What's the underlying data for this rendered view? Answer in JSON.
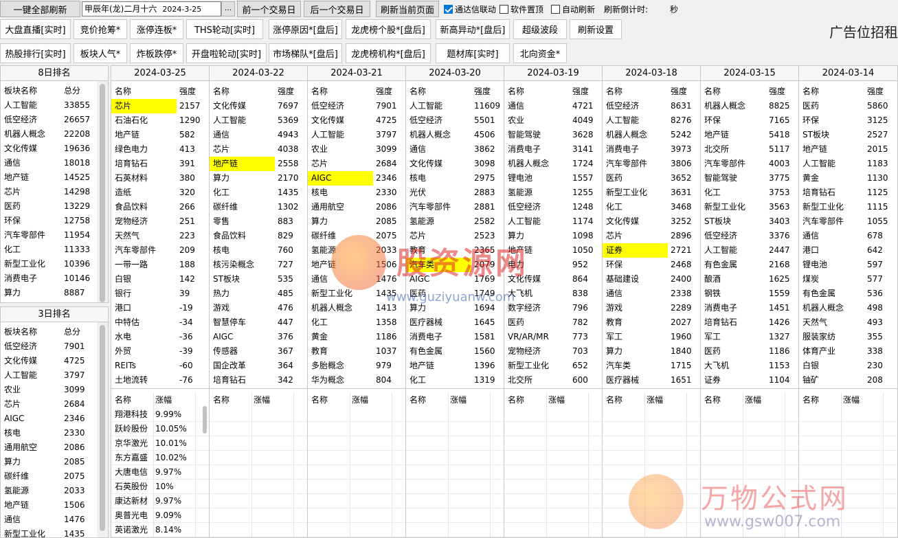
{
  "toolbar": {
    "refresh_all": "一键全部刷新",
    "date_lunar": "甲辰年(龙)二月十六",
    "date_iso": "2024-3-25",
    "dots": "...",
    "prev_day": "前一个交易日",
    "next_day": "后一个交易日",
    "refresh_page": "刷新当前页面",
    "tdx_link": "通达信联动",
    "pin_top": "软件置顶",
    "auto_refresh": "自动刷新",
    "countdown_label": "刷新倒计时:",
    "seconds": "秒",
    "ad_text": "广告位招租"
  },
  "nav_row1": [
    "大盘直播[实时]",
    "竞价抢筹*",
    "涨停连板*",
    "THS轮动[实时]",
    "涨停原因*[盘后]",
    "龙虎榜个股*[盘后]",
    "新高异动*[盘后]",
    "超级波段",
    "刷新设置"
  ],
  "nav_row2": [
    "热股排行[实时]",
    "板块人气*",
    "炸板跌停*",
    "开盘啦轮动[实时]",
    "市场梯队*[盘后]",
    "龙虎榜机构*[盘后]",
    "题材库[实时]",
    "北向资金*"
  ],
  "rank8": {
    "title": "8日排名",
    "col1": "板块名称",
    "col2": "总分",
    "rows": [
      [
        "人工智能",
        "33855"
      ],
      [
        "低空经济",
        "26657"
      ],
      [
        "机器人概念",
        "22208"
      ],
      [
        "文化传媒",
        "19636"
      ],
      [
        "通信",
        "18018"
      ],
      [
        "地产链",
        "14525"
      ],
      [
        "芯片",
        "14298"
      ],
      [
        "医药",
        "13229"
      ],
      [
        "环保",
        "12758"
      ],
      [
        "汽车零部件",
        "11954"
      ],
      [
        "化工",
        "11333"
      ],
      [
        "新型工业化",
        "10396"
      ],
      [
        "消费电子",
        "10146"
      ],
      [
        "算力",
        "8887"
      ]
    ]
  },
  "rank3": {
    "title": "3日排名",
    "col1": "板块名称",
    "col2": "总分",
    "rows": [
      [
        "低空经济",
        "7901"
      ],
      [
        "文化传媒",
        "4725"
      ],
      [
        "人工智能",
        "3797"
      ],
      [
        "农业",
        "3099"
      ],
      [
        "芯片",
        "2684"
      ],
      [
        "AIGC",
        "2346"
      ],
      [
        "核电",
        "2330"
      ],
      [
        "通用航空",
        "2086"
      ],
      [
        "算力",
        "2085"
      ],
      [
        "碳纤维",
        "2075"
      ],
      [
        "氢能源",
        "2033"
      ],
      [
        "地产链",
        "1506"
      ],
      [
        "通信",
        "1476"
      ],
      [
        "新型工业化",
        "1435"
      ]
    ]
  },
  "days": [
    {
      "date": "2024-03-25",
      "col1": "名称",
      "col2": "强度",
      "hl": 0,
      "rows": [
        [
          "芯片",
          "2157"
        ],
        [
          "石油石化",
          "1290"
        ],
        [
          "地产链",
          "582"
        ],
        [
          "绿色电力",
          "413"
        ],
        [
          "培育钻石",
          "391"
        ],
        [
          "石英材料",
          "380"
        ],
        [
          "造纸",
          "320"
        ],
        [
          "食品饮料",
          "266"
        ],
        [
          "宠物经济",
          "251"
        ],
        [
          "天然气",
          "223"
        ],
        [
          "汽车零部件",
          "209"
        ],
        [
          "一带一路",
          "188"
        ],
        [
          "白银",
          "142"
        ],
        [
          "银行",
          "39"
        ],
        [
          "港口",
          "-19"
        ],
        [
          "中特估",
          "-34"
        ],
        [
          "水电",
          "-36"
        ],
        [
          "外贸",
          "-39"
        ],
        [
          "REITs",
          "-60"
        ],
        [
          "土地流转",
          "-76"
        ]
      ],
      "b1": "名称",
      "b2": "涨幅",
      "stocks": [
        [
          "翔港科技",
          "9.99%"
        ],
        [
          "跃岭股份",
          "10.05%"
        ],
        [
          "京华激光",
          "10.01%"
        ],
        [
          "东方嘉盛",
          "10.02%"
        ],
        [
          "大唐电信",
          "9.97%"
        ],
        [
          "石英股份",
          "10%"
        ],
        [
          "康达新材",
          "9.97%"
        ],
        [
          "奥普光电",
          "9.09%"
        ],
        [
          "英诺激光",
          "8.14%"
        ]
      ]
    },
    {
      "date": "2024-03-22",
      "col1": "名称",
      "col2": "强度",
      "hl": 4,
      "rows": [
        [
          "文化传媒",
          "7697"
        ],
        [
          "人工智能",
          "5369"
        ],
        [
          "通信",
          "4943"
        ],
        [
          "芯片",
          "4038"
        ],
        [
          "地产链",
          "2558"
        ],
        [
          "算力",
          "2170"
        ],
        [
          "化工",
          "1435"
        ],
        [
          "碳纤维",
          "1302"
        ],
        [
          "零售",
          "883"
        ],
        [
          "食品饮料",
          "829"
        ],
        [
          "核电",
          "760"
        ],
        [
          "核污染概念",
          "727"
        ],
        [
          "ST板块",
          "535"
        ],
        [
          "热力",
          "485"
        ],
        [
          "游戏",
          "476"
        ],
        [
          "智慧停车",
          "447"
        ],
        [
          "AIGC",
          "376"
        ],
        [
          "传感器",
          "367"
        ],
        [
          "国企改革",
          "364"
        ],
        [
          "培育钻石",
          "342"
        ]
      ],
      "b1": "名称",
      "b2": "涨幅",
      "stocks": []
    },
    {
      "date": "2024-03-21",
      "col1": "名称",
      "col2": "强度",
      "hl": 5,
      "rows": [
        [
          "低空经济",
          "7901"
        ],
        [
          "文化传媒",
          "4725"
        ],
        [
          "人工智能",
          "3797"
        ],
        [
          "农业",
          "3099"
        ],
        [
          "芯片",
          "2684"
        ],
        [
          "AIGC",
          "2346"
        ],
        [
          "核电",
          "2330"
        ],
        [
          "通用航空",
          "2086"
        ],
        [
          "算力",
          "2085"
        ],
        [
          "碳纤维",
          "2075"
        ],
        [
          "氢能源",
          "2033"
        ],
        [
          "地产链",
          "1506"
        ],
        [
          "通信",
          "1476"
        ],
        [
          "新型工业化",
          "1435"
        ],
        [
          "机器人概念",
          "1413"
        ],
        [
          "化工",
          "1358"
        ],
        [
          "黄金",
          "1186"
        ],
        [
          "教育",
          "1037"
        ],
        [
          "多胎概念",
          "979"
        ],
        [
          "华为概念",
          "804"
        ]
      ],
      "b1": "名称",
      "b2": "涨幅",
      "stocks": []
    },
    {
      "date": "2024-03-20",
      "col1": "名称",
      "col2": "强度",
      "hl": 11,
      "rows": [
        [
          "人工智能",
          "11609"
        ],
        [
          "低空经济",
          "5501"
        ],
        [
          "机器人概念",
          "4506"
        ],
        [
          "通信",
          "3862"
        ],
        [
          "文化传媒",
          "3098"
        ],
        [
          "核电",
          "2975"
        ],
        [
          "光伏",
          "2883"
        ],
        [
          "汽车零部件",
          "2881"
        ],
        [
          "氢能源",
          "2582"
        ],
        [
          "芯片",
          "2523"
        ],
        [
          "教育",
          "2365"
        ],
        [
          "汽车类",
          "2079"
        ],
        [
          "AIGC",
          "1769"
        ],
        [
          "医药",
          "1749"
        ],
        [
          "算力",
          "1694"
        ],
        [
          "医疗器械",
          "1645"
        ],
        [
          "消费电子",
          "1581"
        ],
        [
          "有色金属",
          "1560"
        ],
        [
          "地产链",
          "1396"
        ],
        [
          "化工",
          "1319"
        ]
      ],
      "b1": "名称",
      "b2": "涨幅",
      "stocks": []
    },
    {
      "date": "2024-03-19",
      "col1": "名称",
      "col2": "强度",
      "hl": -1,
      "rows": [
        [
          "通信",
          "4721"
        ],
        [
          "农业",
          "4049"
        ],
        [
          "智能驾驶",
          "3628"
        ],
        [
          "消费电子",
          "3141"
        ],
        [
          "机器人概念",
          "1724"
        ],
        [
          "锂电池",
          "1557"
        ],
        [
          "氢能源",
          "1255"
        ],
        [
          "低空经济",
          "1248"
        ],
        [
          "人工智能",
          "1174"
        ],
        [
          "算力",
          "1098"
        ],
        [
          "地产链",
          "1050"
        ],
        [
          "电力",
          "952"
        ],
        [
          "文化传媒",
          "864"
        ],
        [
          "大飞机",
          "838"
        ],
        [
          "数字经济",
          "796"
        ],
        [
          "医药",
          "782"
        ],
        [
          "VR/AR/MR",
          "773"
        ],
        [
          "宠物经济",
          "703"
        ],
        [
          "新型工业化",
          "652"
        ],
        [
          "北交所",
          "600"
        ]
      ],
      "b1": "名称",
      "b2": "涨幅",
      "stocks": []
    },
    {
      "date": "2024-03-18",
      "col1": "名称",
      "col2": "强度",
      "hl": 10,
      "rows": [
        [
          "低空经济",
          "8631"
        ],
        [
          "人工智能",
          "8276"
        ],
        [
          "机器人概念",
          "5242"
        ],
        [
          "消费电子",
          "3973"
        ],
        [
          "汽车零部件",
          "3806"
        ],
        [
          "医药",
          "3652"
        ],
        [
          "新型工业化",
          "3631"
        ],
        [
          "化工",
          "3468"
        ],
        [
          "文化传媒",
          "3252"
        ],
        [
          "芯片",
          "2896"
        ],
        [
          "证券",
          "2721"
        ],
        [
          "环保",
          "2468"
        ],
        [
          "基础建设",
          "2400"
        ],
        [
          "通信",
          "2338"
        ],
        [
          "游戏",
          "2289"
        ],
        [
          "教育",
          "2027"
        ],
        [
          "军工",
          "1960"
        ],
        [
          "算力",
          "1840"
        ],
        [
          "汽车类",
          "1715"
        ],
        [
          "医疗器械",
          "1651"
        ]
      ],
      "b1": "名称",
      "b2": "涨幅",
      "stocks": []
    },
    {
      "date": "2024-03-15",
      "col1": "名称",
      "col2": "强度",
      "hl": -1,
      "rows": [
        [
          "机器人概念",
          "8825"
        ],
        [
          "环保",
          "7165"
        ],
        [
          "地产链",
          "5418"
        ],
        [
          "北交所",
          "5117"
        ],
        [
          "汽车零部件",
          "4003"
        ],
        [
          "智能驾驶",
          "3775"
        ],
        [
          "化工",
          "3753"
        ],
        [
          "新型工业化",
          "3563"
        ],
        [
          "ST板块",
          "3403"
        ],
        [
          "低空经济",
          "3376"
        ],
        [
          "人工智能",
          "2447"
        ],
        [
          "有色金属",
          "2168"
        ],
        [
          "酿酒",
          "1625"
        ],
        [
          "钢铁",
          "1559"
        ],
        [
          "消费电子",
          "1451"
        ],
        [
          "培育钻石",
          "1426"
        ],
        [
          "军工",
          "1327"
        ],
        [
          "医药",
          "1186"
        ],
        [
          "大飞机",
          "1153"
        ],
        [
          "证券",
          "1104"
        ]
      ],
      "b1": "名称",
      "b2": "涨幅",
      "stocks": []
    },
    {
      "date": "2024-03-14",
      "col1": "名称",
      "col2": "强度",
      "hl": -1,
      "rows": [
        [
          "医药",
          "5860"
        ],
        [
          "环保",
          "3125"
        ],
        [
          "ST板块",
          "2527"
        ],
        [
          "地产链",
          "2015"
        ],
        [
          "人工智能",
          "1183"
        ],
        [
          "黄金",
          "1130"
        ],
        [
          "培育钻石",
          "1125"
        ],
        [
          "新型工业化",
          "1115"
        ],
        [
          "汽车零部件",
          "1055"
        ],
        [
          "通信",
          "678"
        ],
        [
          "港口",
          "642"
        ],
        [
          "锂电池",
          "597"
        ],
        [
          "煤炭",
          "577"
        ],
        [
          "有色金属",
          "536"
        ],
        [
          "机器人概念",
          "498"
        ],
        [
          "天然气",
          "493"
        ],
        [
          "服装家纺",
          "355"
        ],
        [
          "体育产业",
          "338"
        ],
        [
          "白银",
          "230"
        ],
        [
          "铀矿",
          "208"
        ]
      ],
      "b1": "名称",
      "b2": "涨幅",
      "stocks": []
    }
  ],
  "watermarks": {
    "w1_text": "股资源网",
    "w1_url": "www.guziyuanw.com",
    "w2_text": "万物公式网",
    "w2_url": "www.gsw007.com"
  }
}
